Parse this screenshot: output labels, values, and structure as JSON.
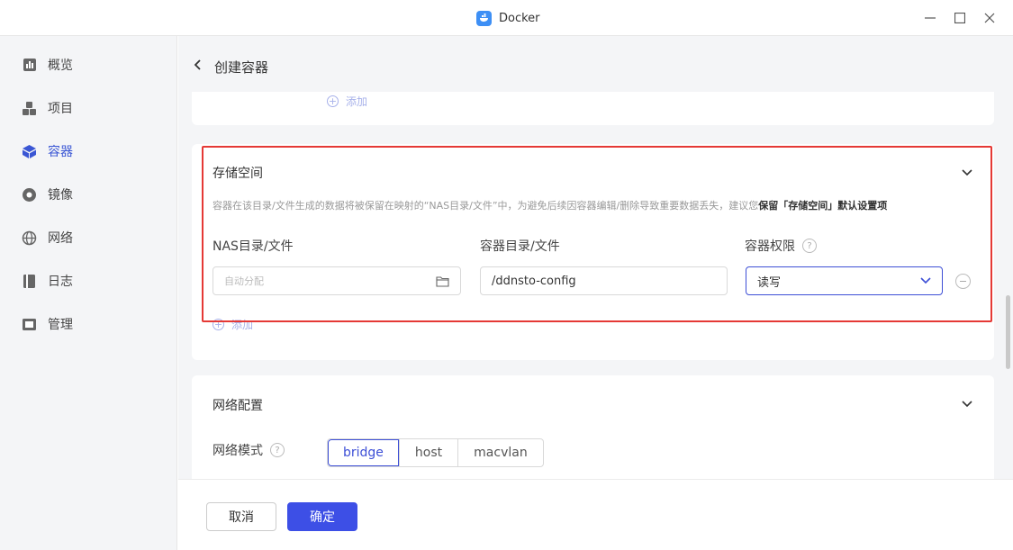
{
  "window": {
    "title": "Docker",
    "controls": [
      "minimize-icon",
      "maximize-icon",
      "close-icon"
    ]
  },
  "sidebar": {
    "items": [
      {
        "label": "概览",
        "icon": "overview-icon"
      },
      {
        "label": "项目",
        "icon": "project-icon"
      },
      {
        "label": "容器",
        "icon": "container-icon",
        "active": true
      },
      {
        "label": "镜像",
        "icon": "image-icon"
      },
      {
        "label": "网络",
        "icon": "network-icon"
      },
      {
        "label": "日志",
        "icon": "log-icon"
      },
      {
        "label": "管理",
        "icon": "manage-icon"
      }
    ]
  },
  "header": {
    "title": "创建容器"
  },
  "top_card": {
    "add_label": "添加"
  },
  "storage": {
    "title": "存储空间",
    "hint_text": "容器在该目录/文件生成的数据将被保留在映射的“NAS目录/文件”中，为避免后续因容器编辑/删除导致重要数据丢失，建议您",
    "hint_bold": "保留「存储空间」默认设置项",
    "col_nas": "NAS目录/文件",
    "col_container": "容器目录/文件",
    "col_perm": "容器权限",
    "nas_placeholder": "自动分配",
    "container_value": "/ddnsto-config",
    "perm_value": "读写",
    "add_label": "添加"
  },
  "network": {
    "title": "网络配置",
    "mode_label": "网络模式",
    "modes": [
      "bridge",
      "host",
      "macvlan"
    ],
    "selected_mode": "bridge"
  },
  "footer": {
    "cancel_label": "取消",
    "ok_label": "确定"
  },
  "colors": {
    "accent": "#3d4fe6",
    "highlight": "#e53935",
    "sidebar_bg": "#f4f5f7"
  }
}
